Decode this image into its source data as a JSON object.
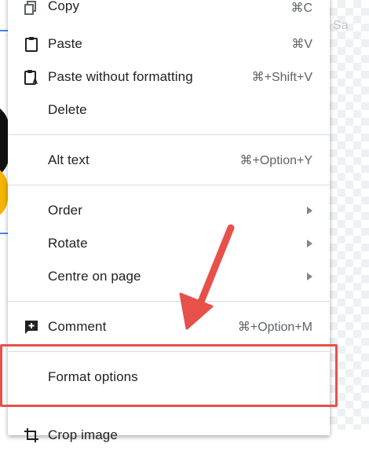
{
  "background": {
    "side_text": "Sa"
  },
  "menu": {
    "items": [
      {
        "label": "Copy",
        "shortcut": "⌘C",
        "icon": "copy-icon"
      },
      {
        "label": "Paste",
        "shortcut": "⌘V",
        "icon": "paste-icon"
      },
      {
        "label": "Paste without formatting",
        "shortcut": "⌘+Shift+V",
        "icon": "paste-without-formatting-icon"
      },
      {
        "label": "Delete"
      },
      {
        "label": "Alt text",
        "shortcut": "⌘+Option+Y"
      },
      {
        "label": "Order",
        "submenu": true
      },
      {
        "label": "Rotate",
        "submenu": true
      },
      {
        "label": "Centre on page",
        "submenu": true
      },
      {
        "label": "Comment",
        "shortcut": "⌘+Option+M",
        "icon": "add-comment-icon"
      },
      {
        "label": "Format options"
      },
      {
        "label": "Crop image",
        "icon": "crop-icon"
      }
    ]
  },
  "annotation": {
    "arrow_color": "#e8504a",
    "highlight_color": "#e8504a"
  }
}
